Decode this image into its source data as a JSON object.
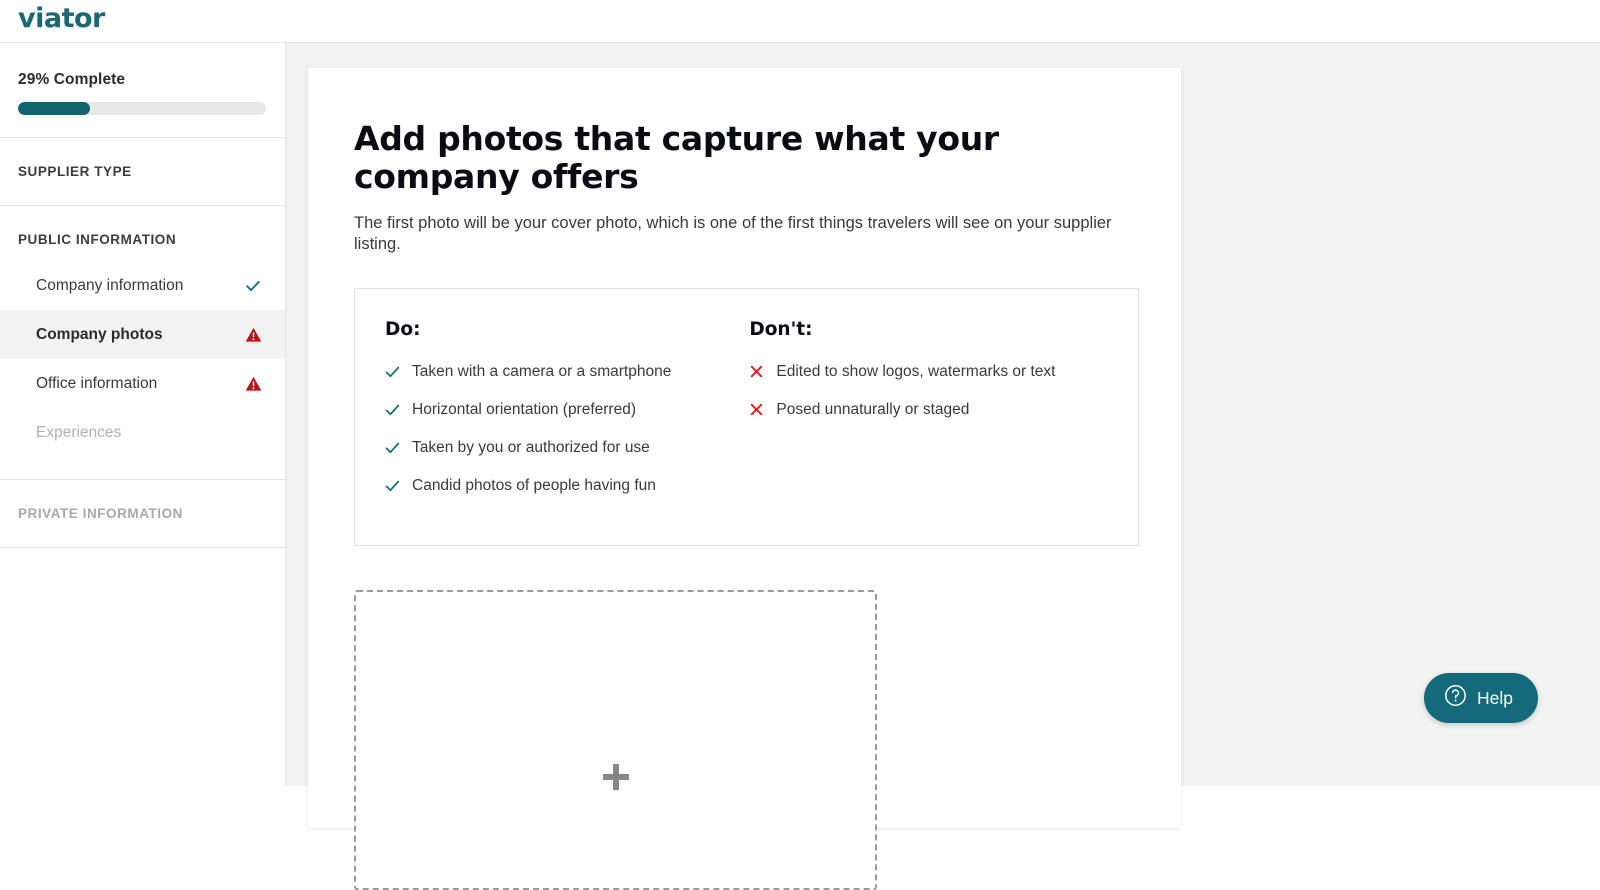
{
  "brand": {
    "logo_text": "viator",
    "teal": "#1a6873",
    "accent_teal": "#11646e",
    "warning_red": "#b81414",
    "x_red": "#e01f1f"
  },
  "sidebar": {
    "progress": {
      "label": "29% Complete",
      "percent": 29
    },
    "sections": [
      {
        "title": "SUPPLIER TYPE",
        "muted": false,
        "items": []
      },
      {
        "title": "PUBLIC INFORMATION",
        "muted": false,
        "items": [
          {
            "label": "Company information",
            "status": "complete",
            "state": "default"
          },
          {
            "label": "Company photos",
            "status": "warning",
            "state": "active"
          },
          {
            "label": "Office information",
            "status": "warning",
            "state": "default"
          },
          {
            "label": "Experiences",
            "status": "none",
            "state": "disabled"
          }
        ]
      },
      {
        "title": "PRIVATE INFORMATION",
        "muted": true,
        "items": []
      }
    ]
  },
  "main": {
    "title": "Add photos that capture what your company offers",
    "subtitle": "The first photo will be your cover photo, which is one of the first things travelers will see on your supplier listing.",
    "guidelines": {
      "do_heading": "Do:",
      "do_items": [
        "Taken with a camera or a smartphone",
        "Horizontal orientation (preferred)",
        "Taken by you or authorized for use",
        "Candid photos of people having fun"
      ],
      "dont_heading": "Don't:",
      "dont_items": [
        "Edited to show logos, watermarks or text",
        "Posed unnaturally or staged"
      ]
    },
    "upload": {
      "icon": "plus-icon"
    }
  },
  "help": {
    "label": "Help",
    "icon": "question-circle-icon"
  }
}
